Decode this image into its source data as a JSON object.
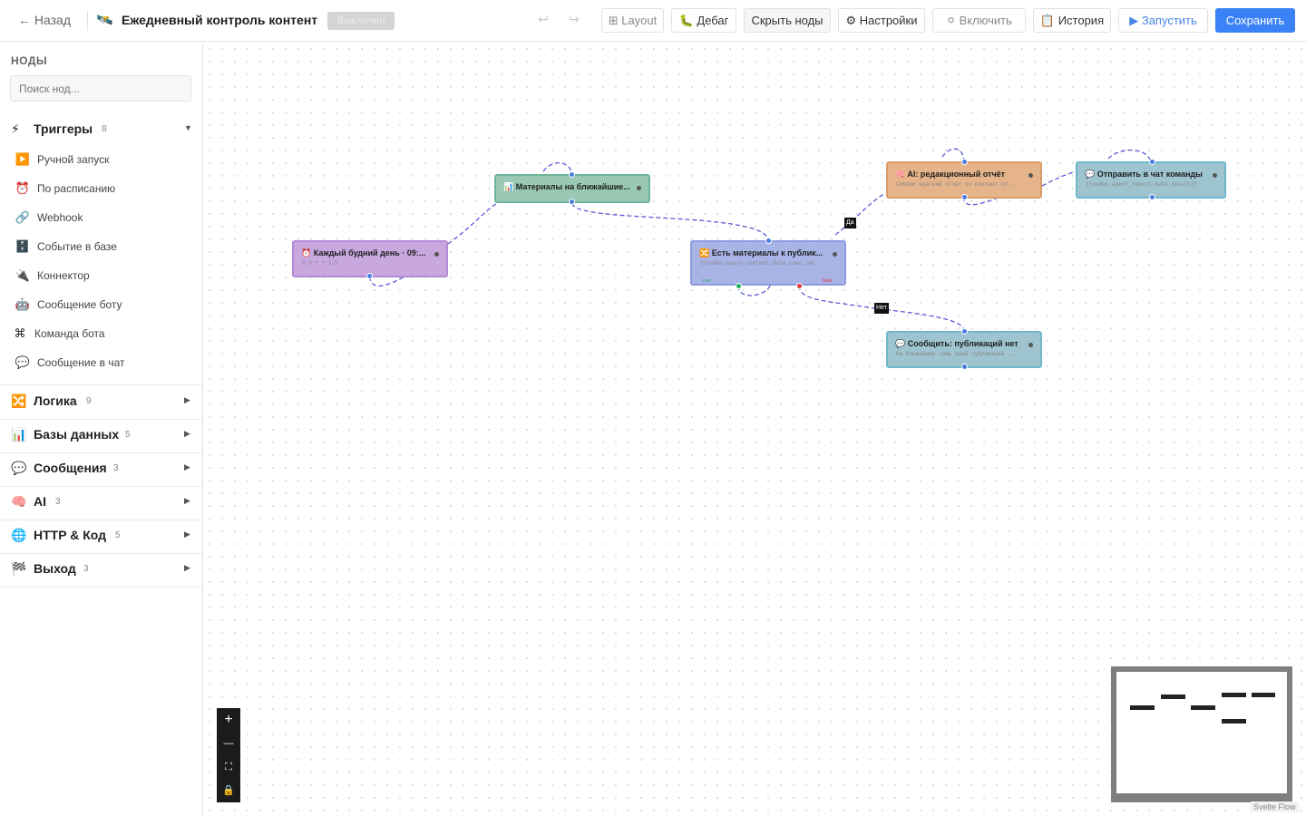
{
  "header": {
    "back_label": "← Назад",
    "workflow_icon": "🛰️",
    "workflow_title": "Ежедневный контроль контент",
    "status": "Выключен",
    "undo": "↩",
    "redo": "↪",
    "buttons": {
      "layout": "⊞ Layout",
      "debug": "🐛 Дебаг",
      "hide_nodes": "Скрыть ноды",
      "settings": "⚙ Настройки",
      "enable": "⚪ Включить",
      "history": "📋 История",
      "run": "▶ Запустить",
      "save": "Сохранить"
    }
  },
  "sidebar": {
    "heading": "НОДЫ",
    "search_placeholder": "Поиск нод...",
    "categories": [
      {
        "icon": "⚡",
        "label": "Триггеры",
        "count": "8",
        "caret": "▼",
        "items": [
          {
            "icon": "▶️",
            "label": "Ручной запуск"
          },
          {
            "icon": "⏰",
            "label": "По расписанию"
          },
          {
            "icon": "🔗",
            "label": "Webhook"
          },
          {
            "icon": "🗄️",
            "label": "Событие в базе"
          },
          {
            "icon": "🔌",
            "label": "Коннектор"
          },
          {
            "icon": "🤖",
            "label": "Сообщение боту"
          },
          {
            "icon": "⌘",
            "label": "Команда бота"
          },
          {
            "icon": "💬",
            "label": "Сообщение в чат"
          }
        ]
      },
      {
        "icon": "🔀",
        "label": "Логика",
        "count": "9",
        "caret": "▶"
      },
      {
        "icon": "📊",
        "label": "Базы данных",
        "count": "5",
        "caret": "▶"
      },
      {
        "icon": "💬",
        "label": "Сообщения",
        "count": "3",
        "caret": "▶"
      },
      {
        "icon": "🧠",
        "label": "AI",
        "count": "3",
        "caret": "▶"
      },
      {
        "icon": "🌐",
        "label": "HTTP & Код",
        "count": "5",
        "caret": "▶"
      },
      {
        "icon": "🏁",
        "label": "Выход",
        "count": "3",
        "caret": "▶"
      }
    ]
  },
  "canvas": {
    "nodes": [
      {
        "id": "schedule",
        "icon": "⏰",
        "title": "Каждый будний день · 09:...",
        "subtitle": "0 9 * * 1-5"
      },
      {
        "id": "materials",
        "icon": "📊",
        "title": "Материалы на ближайшие..."
      },
      {
        "id": "condition",
        "icon": "🔀",
        "title": "Есть материалы к публик...",
        "subtitle": "{{nodes.query_content.data.rows.len",
        "yes_label": "true",
        "no_label": "false"
      },
      {
        "id": "ai_report",
        "icon": "🧠",
        "title": "AI: редакционный отчёт",
        "subtitle": "Собери краткий отчёт по контент-пл..."
      },
      {
        "id": "send_team",
        "icon": "💬",
        "title": "Отправить в чат команды",
        "subtitle": "{{nodes.agent_report.data.result}}"
      },
      {
        "id": "notify_none",
        "icon": "💬",
        "title": "Сообщить: публикаций нет",
        "subtitle": "На ближайшие семь дней публикаций ..."
      }
    ],
    "edge_labels": {
      "yes": "Да",
      "no": "Нет"
    },
    "controls": {
      "zoom_in": "+",
      "zoom_out": "—",
      "fit": "⛶",
      "lock": "🔒"
    },
    "attribution": "Svelte Flow"
  },
  "colors": {
    "primary": "#3b82f6",
    "trigger_node": "#c9a8e0",
    "db_node": "#9ac8b4",
    "logic_node": "#a9b4e6",
    "ai_node": "#e6b48a",
    "message_node": "#9ec4cf",
    "edge": "#5a5ad6"
  }
}
